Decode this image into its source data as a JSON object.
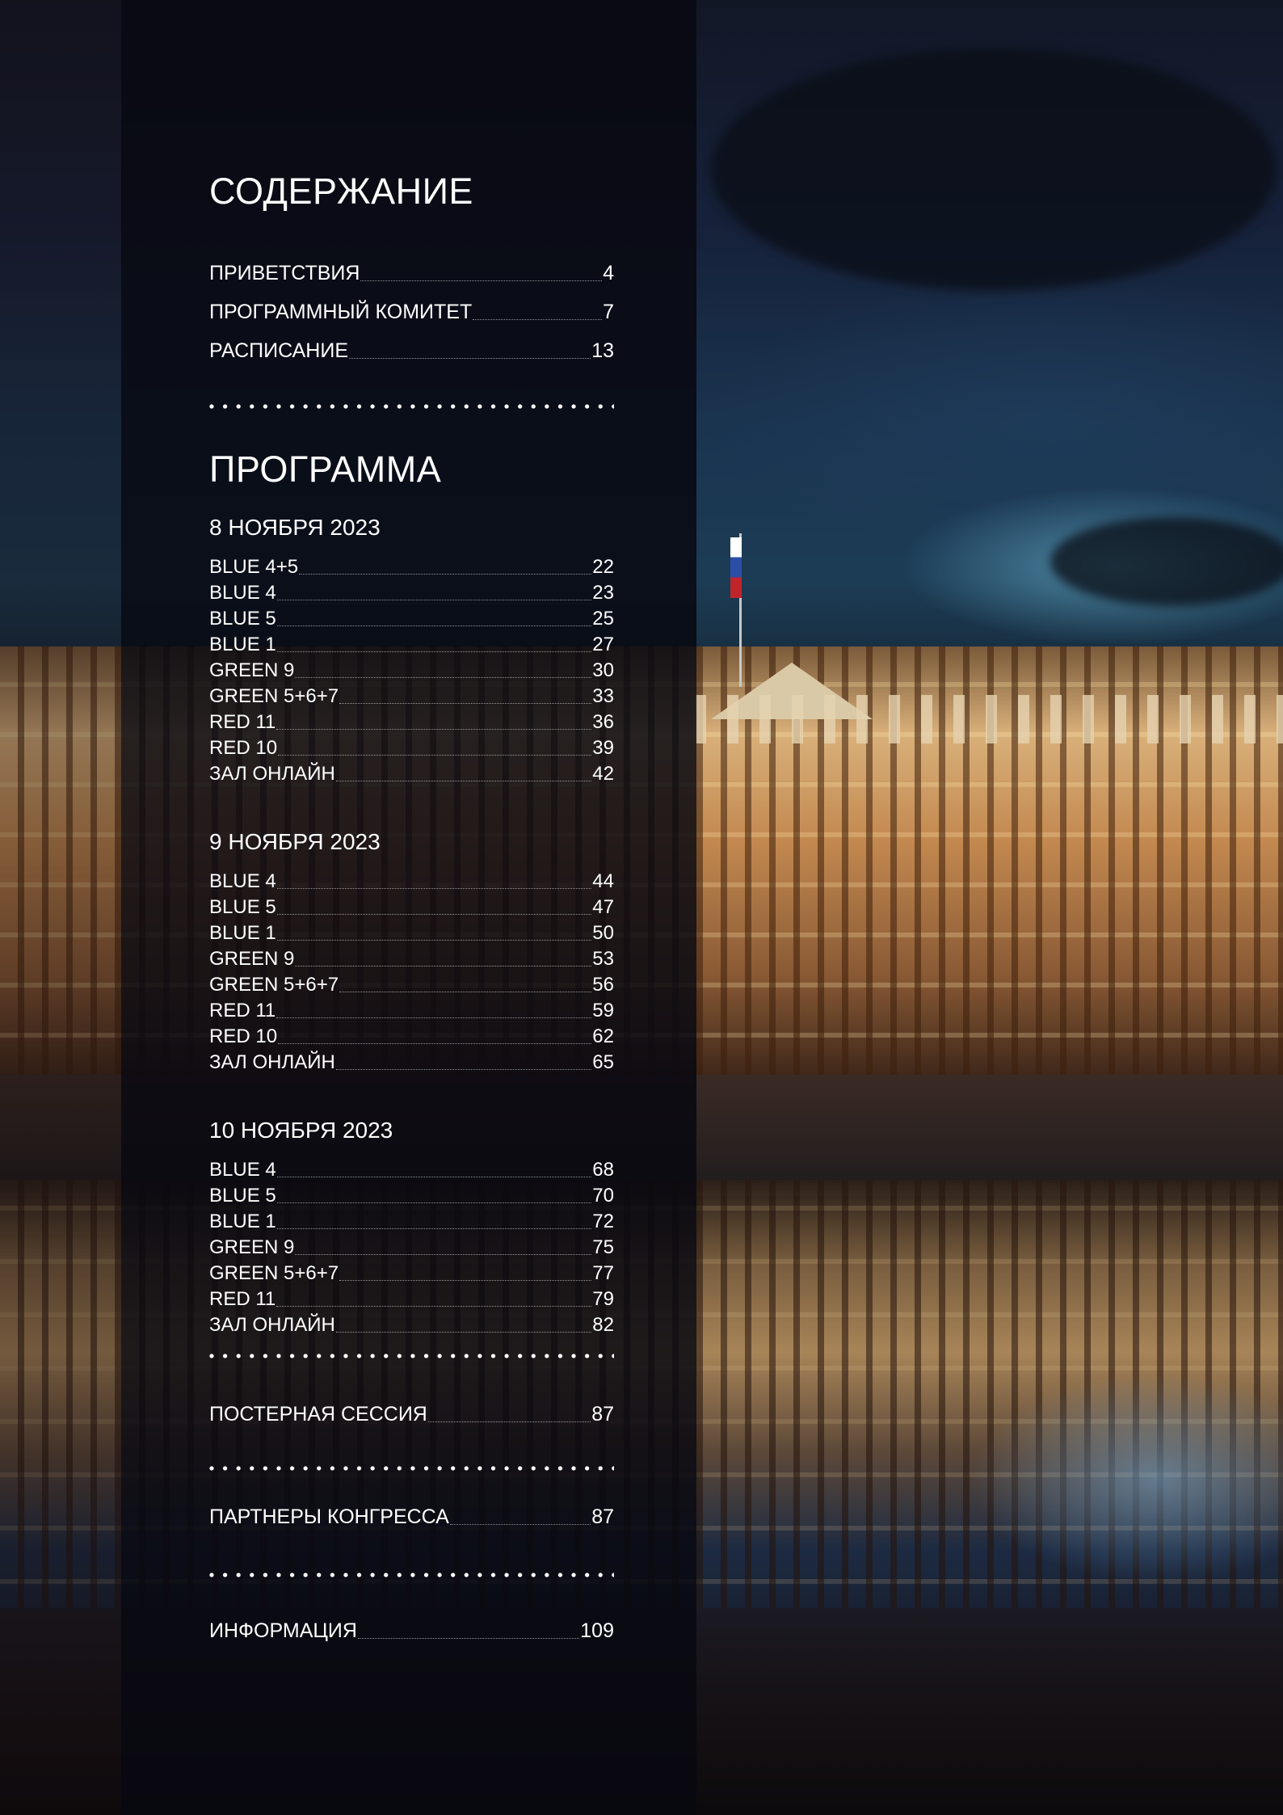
{
  "toc": {
    "title": "СОДЕРЖАНИЕ",
    "items": [
      {
        "label": "ПРИВЕТСТВИЯ",
        "page": "4"
      },
      {
        "label": "ПРОГРАММНЫЙ КОМИТЕТ",
        "page": "7"
      },
      {
        "label": "РАСПИСАНИЕ",
        "page": "13"
      }
    ]
  },
  "program": {
    "title": "ПРОГРАММА",
    "days": [
      {
        "date": "8 НОЯБРЯ 2023",
        "items": [
          {
            "label": "BLUE 4+5",
            "page": "22"
          },
          {
            "label": "BLUE 4",
            "page": "23"
          },
          {
            "label": "BLUE 5",
            "page": "25"
          },
          {
            "label": "BLUE 1",
            "page": "27"
          },
          {
            "label": "GREEN 9",
            "page": "30"
          },
          {
            "label": "GREEN 5+6+7",
            "page": "33"
          },
          {
            "label": "RED 11",
            "page": "36"
          },
          {
            "label": "RED 10",
            "page": "39"
          },
          {
            "label": "ЗАЛ ОНЛАЙН",
            "page": "42"
          }
        ]
      },
      {
        "date": "9 НОЯБРЯ 2023",
        "items": [
          {
            "label": "BLUE 4",
            "page": "44"
          },
          {
            "label": "BLUE 5",
            "page": "47"
          },
          {
            "label": "BLUE 1",
            "page": "50"
          },
          {
            "label": "GREEN 9",
            "page": "53"
          },
          {
            "label": "GREEN 5+6+7",
            "page": "56"
          },
          {
            "label": "RED 11",
            "page": "59"
          },
          {
            "label": "RED 10",
            "page": "62"
          },
          {
            "label": "ЗАЛ ОНЛАЙН",
            "page": "65"
          }
        ]
      },
      {
        "date": "10 НОЯБРЯ 2023",
        "items": [
          {
            "label": "BLUE 4",
            "page": "68"
          },
          {
            "label": "BLUE 5",
            "page": "70"
          },
          {
            "label": "BLUE 1",
            "page": "72"
          },
          {
            "label": "GREEN 9",
            "page": "75"
          },
          {
            "label": "GREEN 5+6+7",
            "page": "77"
          },
          {
            "label": "RED 11",
            "page": "79"
          },
          {
            "label": "ЗАЛ ОНЛАЙН",
            "page": "82"
          }
        ]
      }
    ]
  },
  "sections": [
    {
      "label": "ПОСТЕРНАЯ СЕССИЯ",
      "page": "87"
    },
    {
      "label": "ПАРТНЕРЫ КОНГРЕССА",
      "page": "87"
    },
    {
      "label": "ИНФОРМАЦИЯ",
      "page": "109"
    }
  ]
}
